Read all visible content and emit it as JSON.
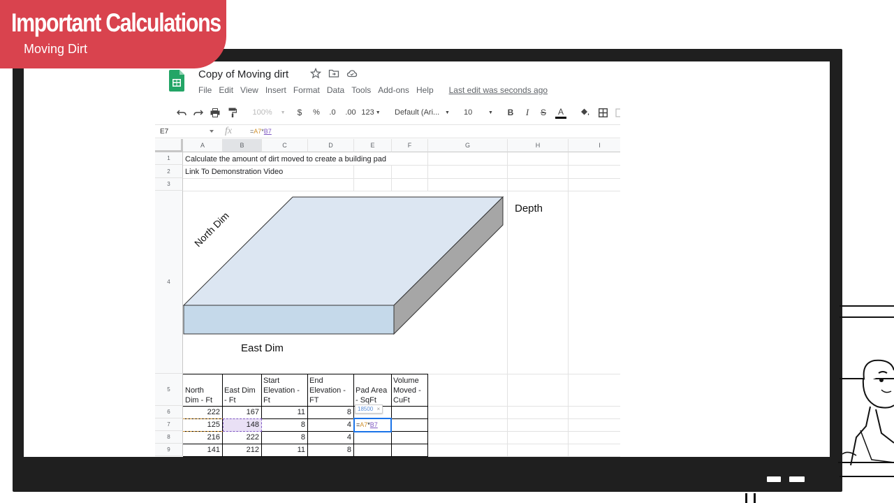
{
  "overlay": {
    "title": "Important Calculations",
    "subtitle": "Moving Dirt",
    "banner_color": "#d9434e"
  },
  "app": {
    "doc_title": "Copy of Moving dirt",
    "title_icons": [
      "star-icon",
      "move-to-folder-icon",
      "cloud-status-icon"
    ],
    "menu": [
      "File",
      "Edit",
      "View",
      "Insert",
      "Format",
      "Data",
      "Tools",
      "Add-ons",
      "Help"
    ],
    "last_edit": "Last edit was seconds ago",
    "toolbar": {
      "zoom": "100%",
      "currency": "$",
      "percent": "%",
      "dec_decrease": ".0",
      "dec_increase": ".00",
      "more_formats": "123",
      "font": "Default (Ari...",
      "font_size": "10",
      "bold": "B",
      "italic": "I",
      "strike": "S",
      "text_color": "A"
    },
    "formula_bar": {
      "name_box": "E7",
      "fx": "fx",
      "formula_prefix": "=",
      "ref_a": "A7",
      "operator": "*",
      "ref_b": "B7"
    }
  },
  "sheet": {
    "columns": [
      "A",
      "B",
      "C",
      "D",
      "E",
      "F",
      "G",
      "H",
      "I"
    ],
    "rows": [
      "1",
      "2",
      "3",
      "4",
      "5",
      "6",
      "7",
      "8",
      "9"
    ],
    "cells": {
      "a1": "Calculate the amount of dirt moved to create a building pad",
      "a2": "Link To Demonstration Video"
    },
    "diagram": {
      "north_label": "North Dim",
      "east_label": "East Dim",
      "depth_label": "Depth",
      "top_color": "#dce6f2",
      "front_color": "#c5d9ea",
      "side_color": "#a6a6a6"
    },
    "table": {
      "headers": [
        [
          "North",
          "Dim - Ft"
        ],
        [
          "East Dim",
          "- Ft"
        ],
        [
          "Start",
          "Elevation -",
          "Ft"
        ],
        [
          "End",
          "Elevation -",
          "FT"
        ],
        [
          "Pad Area",
          "- SqFt"
        ],
        [
          "Volume",
          "Moved -",
          "CuFt"
        ]
      ],
      "rows": [
        [
          "222",
          "167",
          "11",
          "8"
        ],
        [
          "125",
          "148",
          "8",
          "4"
        ],
        [
          "216",
          "222",
          "8",
          "4"
        ],
        [
          "141",
          "212",
          "11",
          "8"
        ]
      ],
      "edit_tooltip": "18500",
      "tooltip_close": "×"
    }
  }
}
